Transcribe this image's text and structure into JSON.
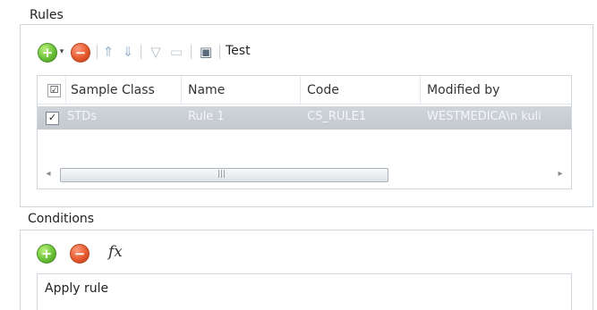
{
  "rules": {
    "title": "Rules",
    "toolbar": {
      "add_icon": "plus-icon",
      "dropdown_icon": "chevron-down-icon",
      "remove_icon": "minus-icon",
      "move_up_icon": "arrow-up-icon",
      "move_down_icon": "arrow-down-icon",
      "filter_icon": "filter-icon",
      "clear_filter_icon": "clear-filter-icon",
      "test_icon": "test-icon",
      "test_label": "Test"
    },
    "grid": {
      "columns": [
        "Sample Class",
        "Name",
        "Code",
        "Modified by"
      ],
      "rows": [
        {
          "checked": true,
          "sample_class": "STDs",
          "name": "Rule 1",
          "code": "CS_RULE1",
          "modified_by": "WESTMEDICA\\n kuli"
        }
      ]
    }
  },
  "conditions": {
    "title": "Conditions",
    "fx_label": "fx",
    "text": "Apply rule"
  },
  "colors": {
    "add": "#6cc23a",
    "remove": "#e65a2e",
    "selected_row": "#c8cdd3",
    "border": "#cfd6dd"
  }
}
